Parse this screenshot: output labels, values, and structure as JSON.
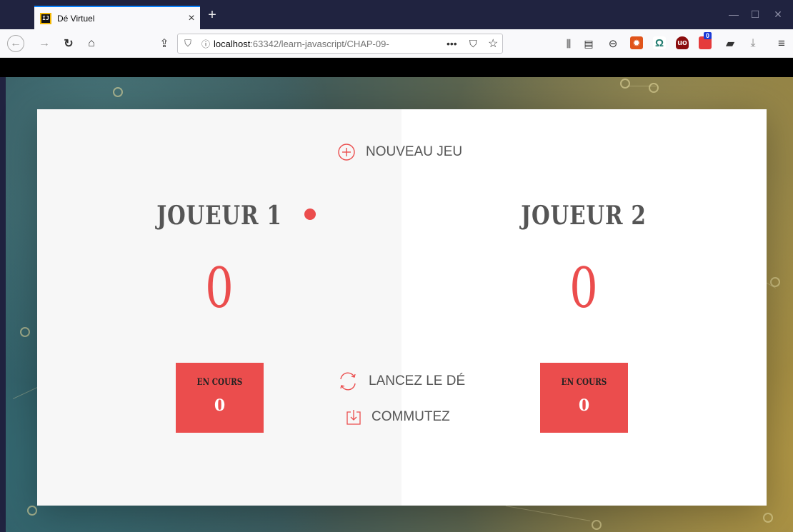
{
  "browser": {
    "tab_title": "Dé Virtuel",
    "tab_favicon": "IJ",
    "url_host": "localhost",
    "url_path": ":63342/learn-javascript/CHAP-09-",
    "badge_count": "0"
  },
  "game": {
    "new_game": "NOUVEAU JEU",
    "roll": "LANCEZ LE DÉ",
    "hold": "COMMUTEZ",
    "players": [
      {
        "name": "JOUEUR 1",
        "score": "0",
        "current_label": "EN COURS",
        "current_score": "0",
        "active": true
      },
      {
        "name": "JOUEUR 2",
        "score": "0",
        "current_label": "EN COURS",
        "current_score": "0",
        "active": false
      }
    ]
  },
  "colors": {
    "accent": "#eb4d4d",
    "text": "#555555",
    "chrome_dark": "#202340"
  }
}
